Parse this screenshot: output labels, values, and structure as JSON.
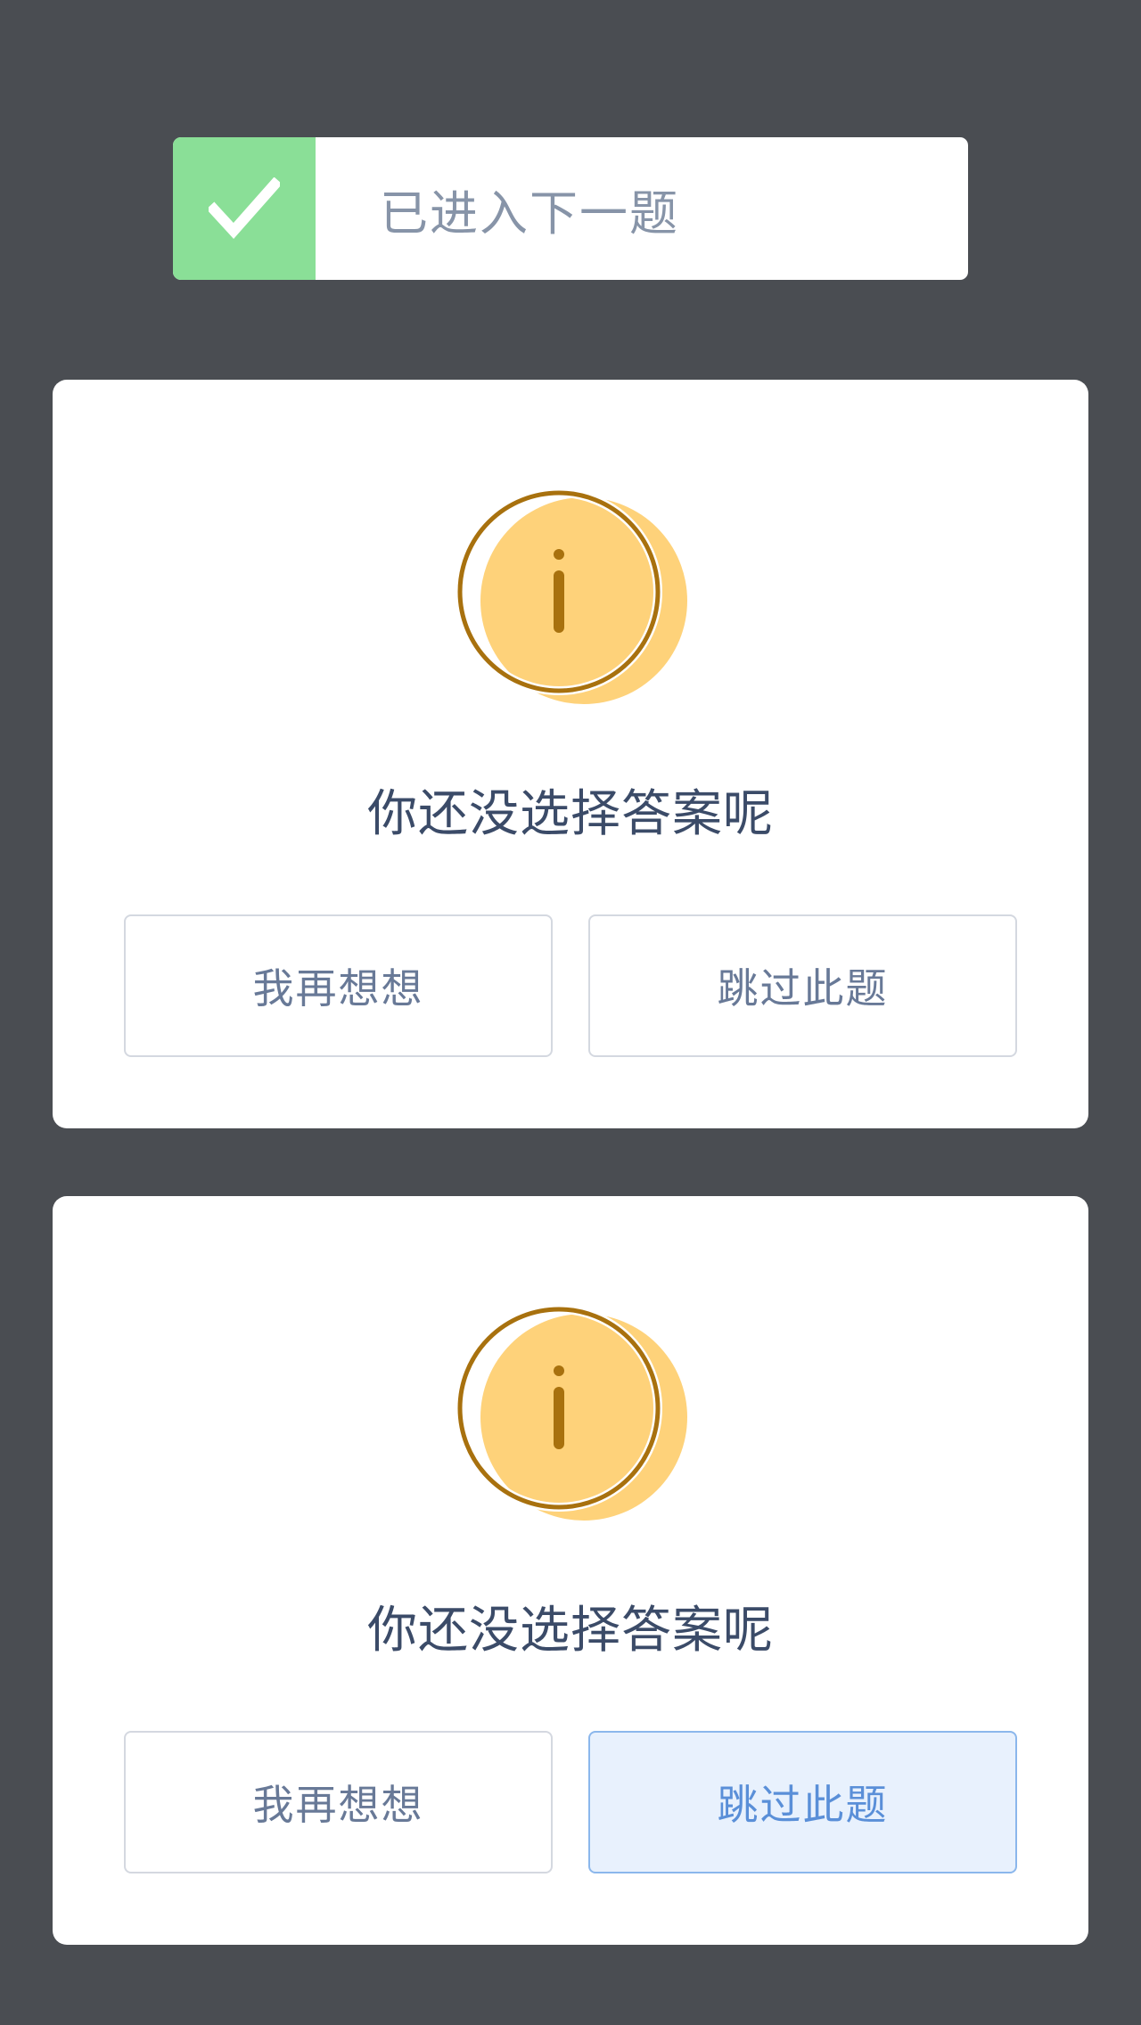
{
  "toast": {
    "icon": "check-icon",
    "message": "已进入下一题",
    "badge_color": "#8adf97"
  },
  "dialogs": [
    {
      "icon": "info-icon",
      "message": "你还没选择答案呢",
      "buttons": {
        "think_again": "我再想想",
        "skip": "跳过此题"
      },
      "skip_state": "normal"
    },
    {
      "icon": "info-icon",
      "message": "你还没选择答案呢",
      "buttons": {
        "think_again": "我再想想",
        "skip": "跳过此题"
      },
      "skip_state": "pressed"
    }
  ],
  "colors": {
    "background": "#4a4d52",
    "icon_fill": "#fed27a",
    "icon_stroke": "#a8710e",
    "accent_blue": "#5a8fd8"
  }
}
